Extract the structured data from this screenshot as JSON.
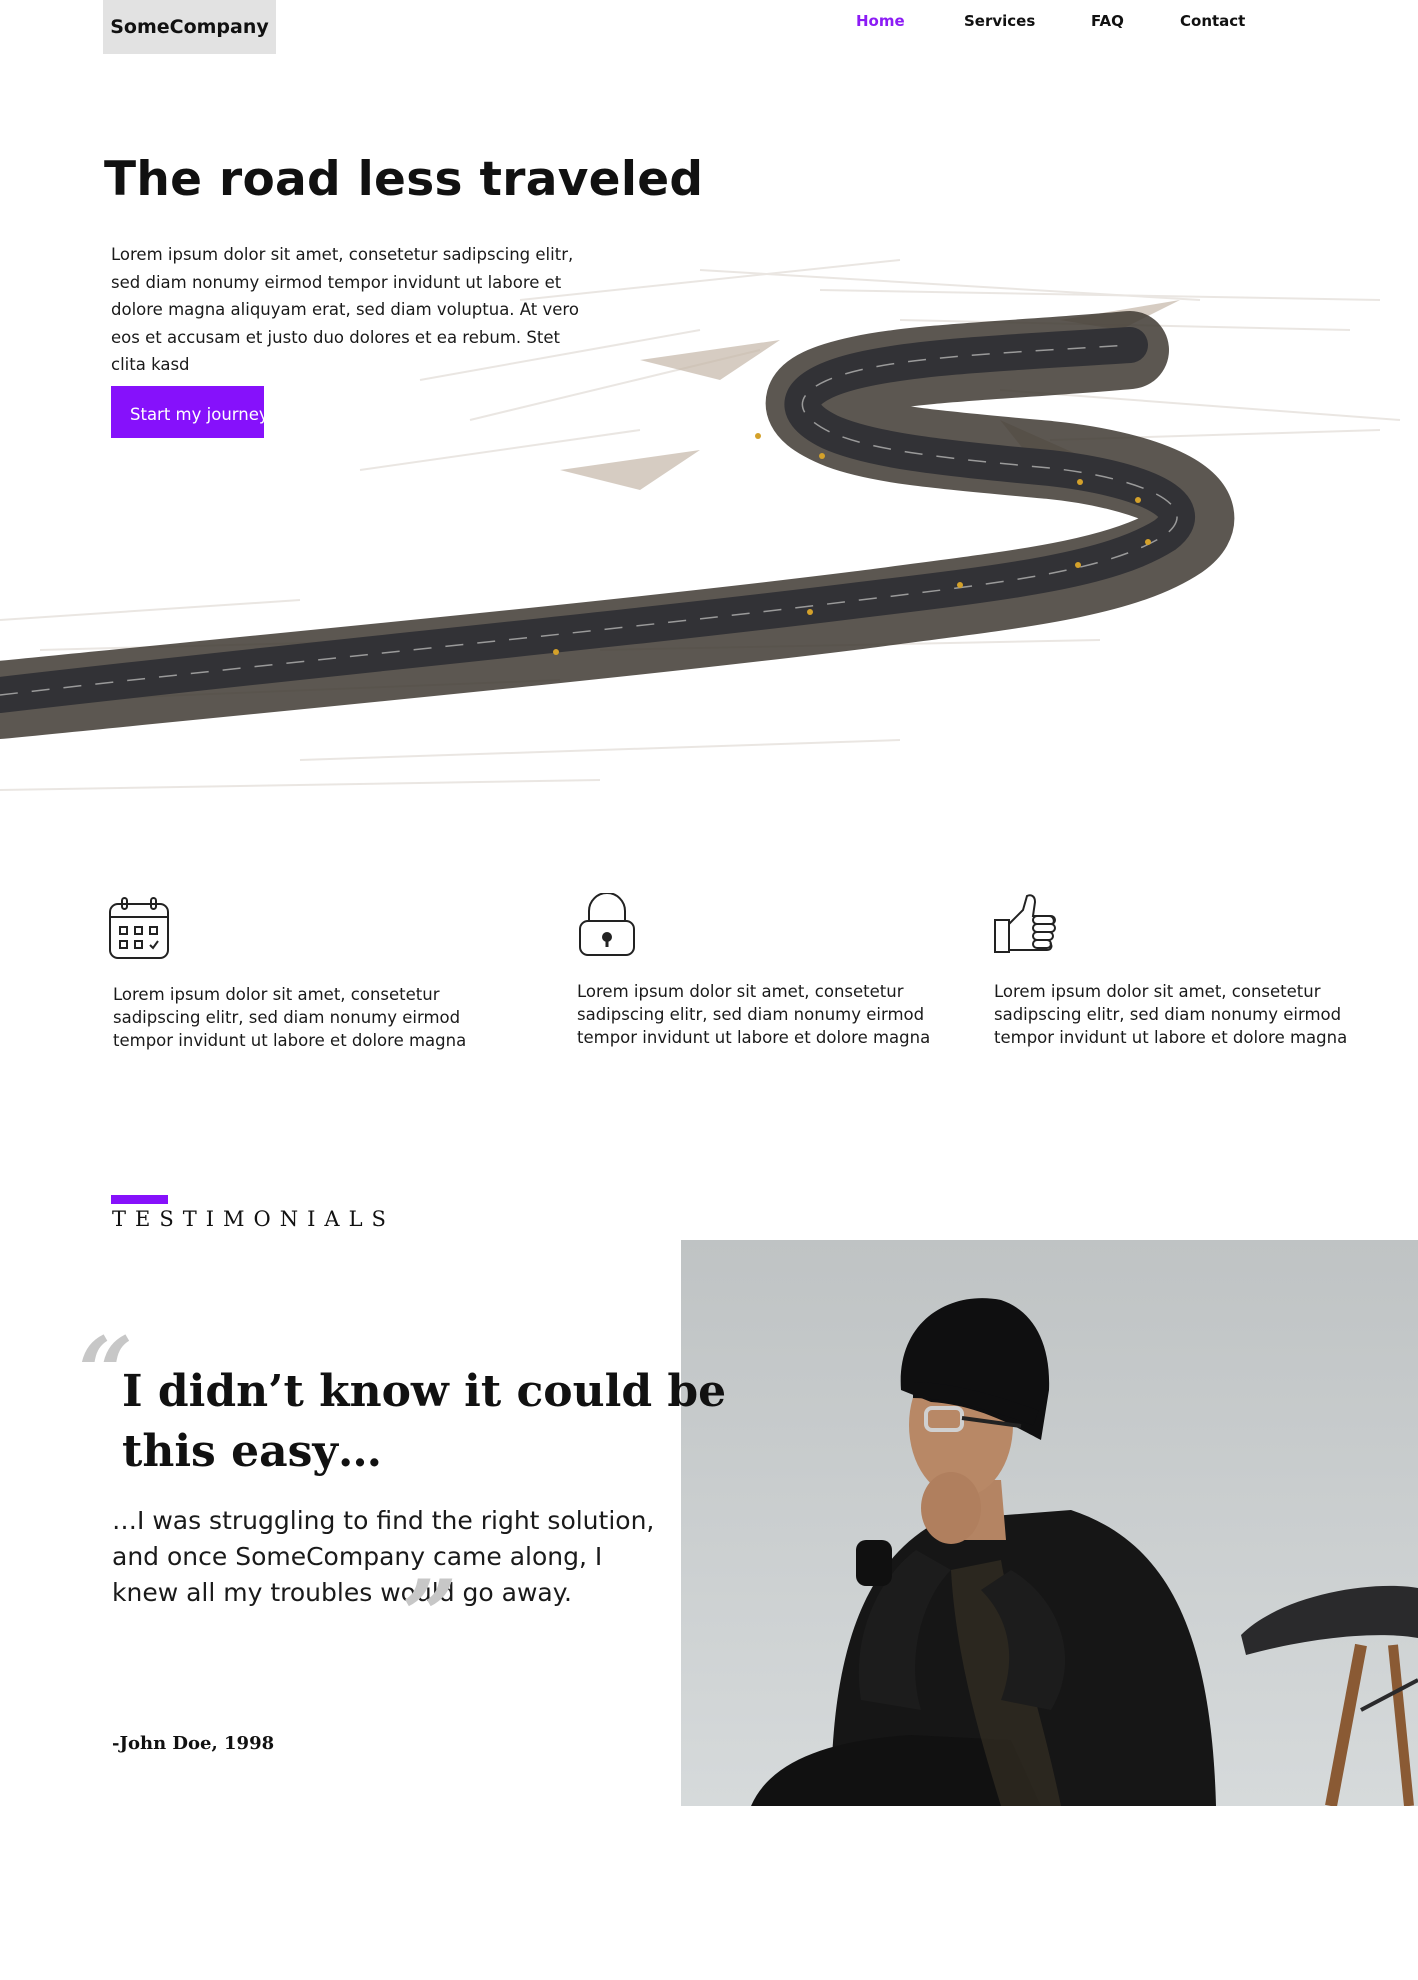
{
  "header": {
    "logo": "SomeCompany",
    "nav": [
      {
        "label": "Home",
        "active": true
      },
      {
        "label": "Services",
        "active": false
      },
      {
        "label": "FAQ",
        "active": false
      },
      {
        "label": "Contact",
        "active": false
      }
    ]
  },
  "hero": {
    "title": "The road less traveled",
    "body": "Lorem ipsum dolor sit amet, consetetur sadipscing elitr, sed diam nonumy eirmod tempor invidunt ut labore et dolore magna aliquyam erat, sed diam voluptua. At vero eos et accusam et justo duo dolores et ea rebum. Stet clita kasd",
    "cta_label": "Start my journey"
  },
  "features": [
    {
      "icon": "calendar-icon",
      "text": "Lorem ipsum dolor sit amet, consetetur sadipscing elitr, sed diam nonumy eirmod tempor invidunt ut labore et dolore magna"
    },
    {
      "icon": "lock-icon",
      "text": "Lorem ipsum dolor sit amet, consetetur sadipscing elitr, sed diam nonumy eirmod tempor invidunt ut labore et dolore magna"
    },
    {
      "icon": "thumbs-up-icon",
      "text": "Lorem ipsum dolor sit amet, consetetur sadipscing elitr, sed diam nonumy eirmod tempor invidunt ut labore et dolore magna"
    }
  ],
  "testimonials": {
    "heading": "TESTIMONIALS",
    "quote_title": "I didn’t know it could be this easy…",
    "quote_body": "…I was struggling to find the right solution, and once SomeCompany came along, I knew all my troubles would go away.",
    "author": "-John Doe, 1998"
  },
  "colors": {
    "accent": "#8611fb",
    "nav_active": "#8c1cf5",
    "logo_bg": "#e2e2e2"
  }
}
